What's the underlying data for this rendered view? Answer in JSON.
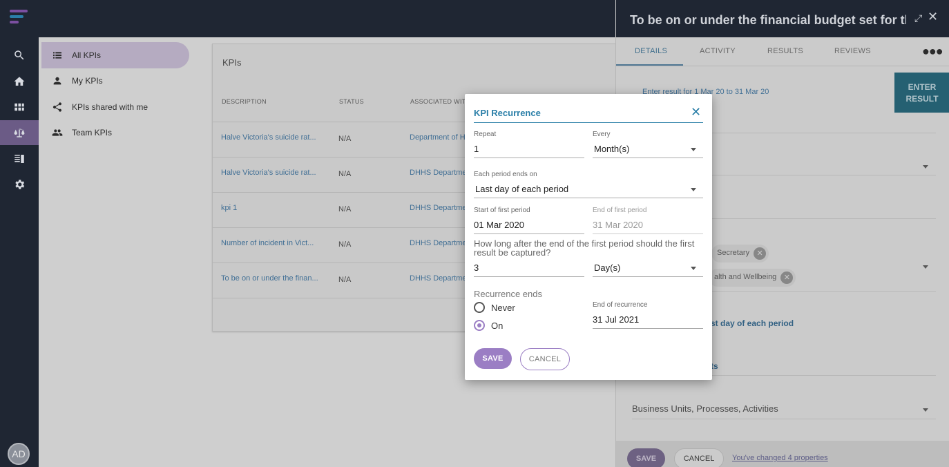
{
  "rail": {
    "avatar_initials": "AD",
    "logo_colors": [
      "#7b4fa0",
      "#2b7fa8",
      "#7b4fa0"
    ]
  },
  "nav": {
    "items": [
      {
        "label": "All KPIs",
        "icon": "list-icon"
      },
      {
        "label": "My KPIs",
        "icon": "person-icon"
      },
      {
        "label": "KPIs shared with me",
        "icon": "share-icon"
      },
      {
        "label": "Team KPIs",
        "icon": "people-icon"
      }
    ]
  },
  "kpis": {
    "title": "KPIs",
    "columns": [
      "DESCRIPTION",
      "STATUS",
      "ASSOCIATED WIT"
    ],
    "rows": [
      {
        "description": "Halve Victoria's suicide rat...",
        "status": "N/A",
        "associated": "Department of H"
      },
      {
        "description": "Halve Victoria's suicide rat...",
        "status": "N/A",
        "associated": "DHHS Departmen"
      },
      {
        "description": "kpi 1",
        "status": "N/A",
        "associated": "DHHS Departmen"
      },
      {
        "description": "Number of incident in Vict...",
        "status": "N/A",
        "associated": "DHHS Departmen"
      },
      {
        "description": "To be on or under the finan...",
        "status": "N/A",
        "associated": "DHHS Departmen"
      }
    ]
  },
  "panel": {
    "title": "To be on or under the financial budget set for th...",
    "tabs": [
      "DETAILS",
      "ACTIVITY",
      "RESULTS",
      "REVIEWS"
    ],
    "enter_text": "Enter result for 1 Mar 20 to 31 Mar 20",
    "enter_button": "ENTER RESULT",
    "chip_1": "Secretary",
    "chip_2": "alth and Wellbeing",
    "period_text": "st day of each period",
    "ts_text": "ts",
    "bu_field": "Business Units, Processes, Activities",
    "save": "SAVE",
    "cancel": "CANCEL",
    "changed": "You've changed 4 properties"
  },
  "modal": {
    "title": "KPI Recurrence",
    "repeat_label": "Repeat",
    "repeat_value": "1",
    "every_label": "Every",
    "every_value": "Month(s)",
    "period_end_label": "Each period ends on",
    "period_end_value": "Last day of each period",
    "start_label": "Start of first period",
    "start_value": "01 Mar 2020",
    "end_label": "End of first period",
    "end_value": "31 Mar 2020",
    "question": "How long after the end of the first period should the first result be captured?",
    "after_value": "3",
    "after_unit": "Day(s)",
    "recurrence_ends_label": "Recurrence ends",
    "never_label": "Never",
    "on_label": "On",
    "end_of_recurrence_label": "End of recurrence",
    "end_of_recurrence_value": "31 Jul 2021",
    "save": "SAVE",
    "cancel": "CANCEL"
  }
}
